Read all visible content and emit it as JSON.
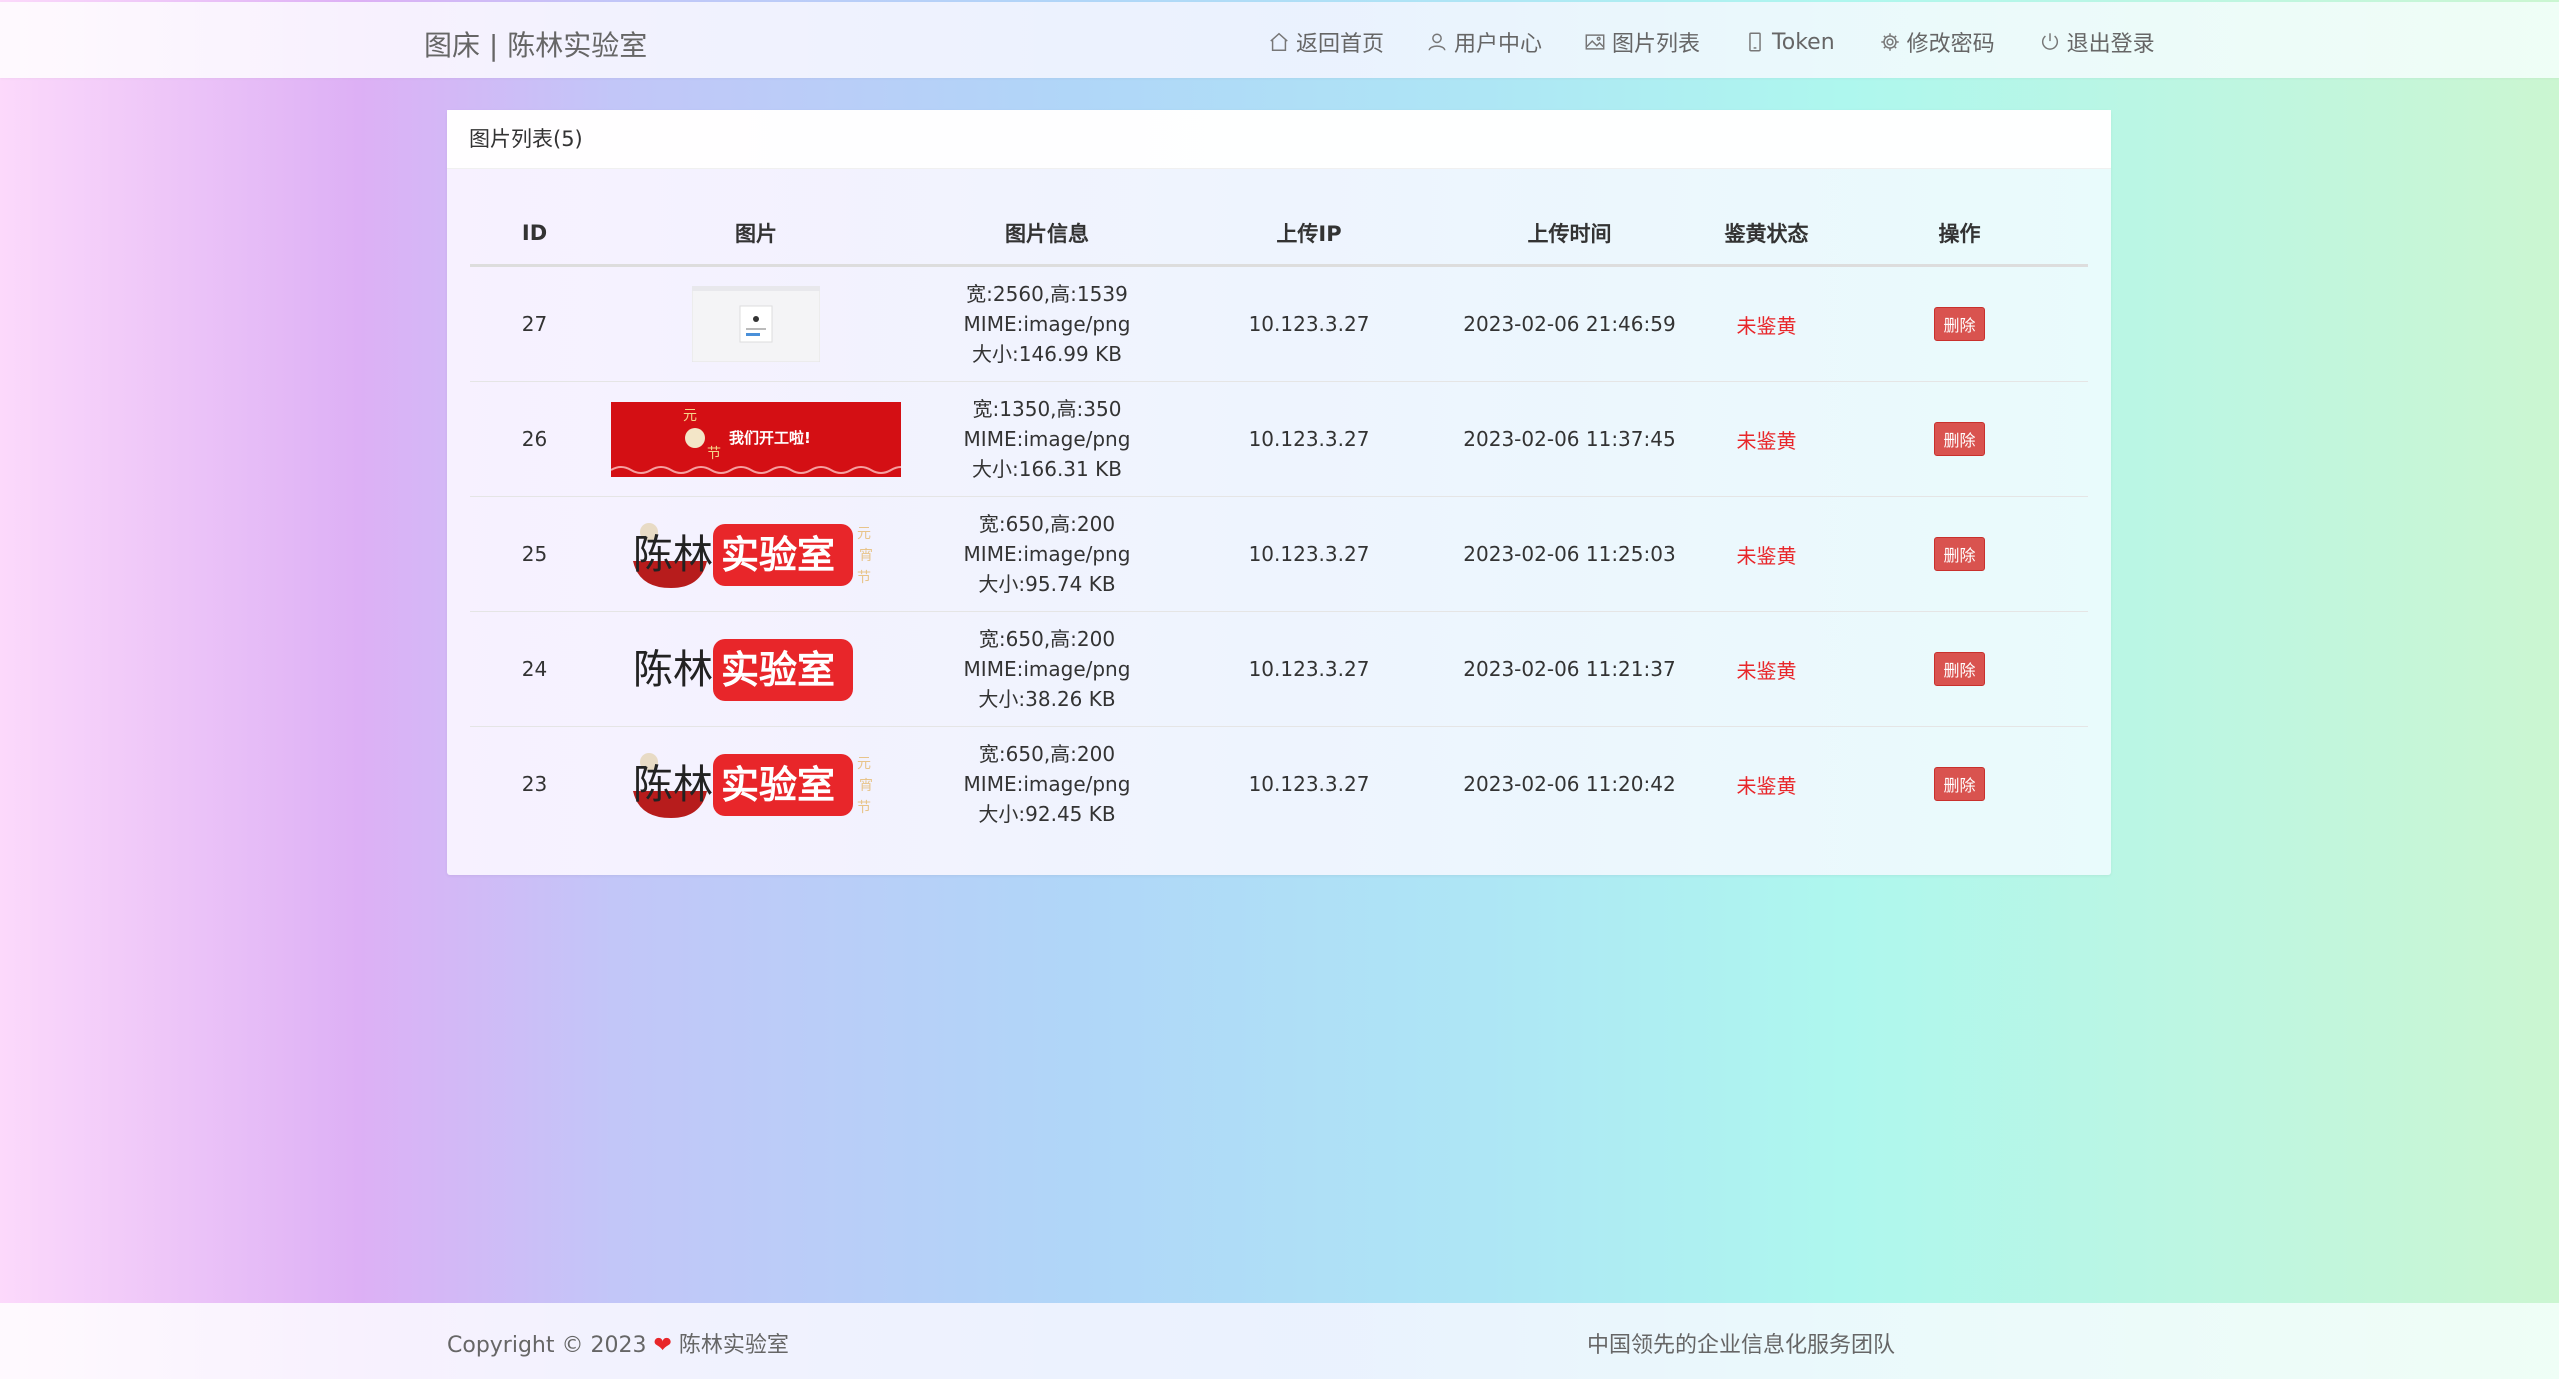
{
  "header": {
    "brand": "图床 | 陈林实验室",
    "nav": [
      {
        "label": "返回首页",
        "icon": "home-icon"
      },
      {
        "label": "用户中心",
        "icon": "user-icon"
      },
      {
        "label": "图片列表",
        "icon": "image-icon"
      },
      {
        "label": "Token",
        "icon": "phone-icon"
      },
      {
        "label": "修改密码",
        "icon": "gear-icon"
      },
      {
        "label": "退出登录",
        "icon": "power-icon"
      }
    ]
  },
  "panel": {
    "title": "图片列表(5)",
    "columns": [
      "ID",
      "图片",
      "图片信息",
      "上传IP",
      "上传时间",
      "鉴黄状态",
      "操作"
    ],
    "rows": [
      {
        "id": "27",
        "thumb": "screenshot-thumbnail",
        "info": [
          "宽:2560,高:1539",
          "MIME:image/png",
          "大小:146.99 KB"
        ],
        "ip": "10.123.3.27",
        "time": "2023-02-06 21:46:59",
        "status": "未鉴黄",
        "action": "删除"
      },
      {
        "id": "26",
        "thumb": "banner-thumbnail",
        "thumb_text": "我们开工啦!",
        "info": [
          "宽:1350,高:350",
          "MIME:image/png",
          "大小:166.31 KB"
        ],
        "ip": "10.123.3.27",
        "time": "2023-02-06 11:37:45",
        "status": "未鉴黄",
        "action": "删除"
      },
      {
        "id": "25",
        "thumb": "logo-thumbnail",
        "logo_left": "陈林",
        "logo_right": "实验室",
        "info": [
          "宽:650,高:200",
          "MIME:image/png",
          "大小:95.74 KB"
        ],
        "ip": "10.123.3.27",
        "time": "2023-02-06 11:25:03",
        "status": "未鉴黄",
        "action": "删除"
      },
      {
        "id": "24",
        "thumb": "logo-thumbnail",
        "logo_left": "陈林",
        "logo_right": "实验室",
        "info": [
          "宽:650,高:200",
          "MIME:image/png",
          "大小:38.26 KB"
        ],
        "ip": "10.123.3.27",
        "time": "2023-02-06 11:21:37",
        "status": "未鉴黄",
        "action": "删除"
      },
      {
        "id": "23",
        "thumb": "logo-thumbnail",
        "logo_left": "陈林",
        "logo_right": "实验室",
        "info": [
          "宽:650,高:200",
          "MIME:image/png",
          "大小:92.45 KB"
        ],
        "ip": "10.123.3.27",
        "time": "2023-02-06 11:20:42",
        "status": "未鉴黄",
        "action": "删除"
      }
    ]
  },
  "footer": {
    "copyright": "Copyright © 2023",
    "lab": "陈林实验室",
    "slogan": "中国领先的企业信息化服务团队"
  },
  "colors": {
    "status": "#e8262a",
    "delete_button": "#d9534f",
    "logo_red": "#e8262a"
  }
}
